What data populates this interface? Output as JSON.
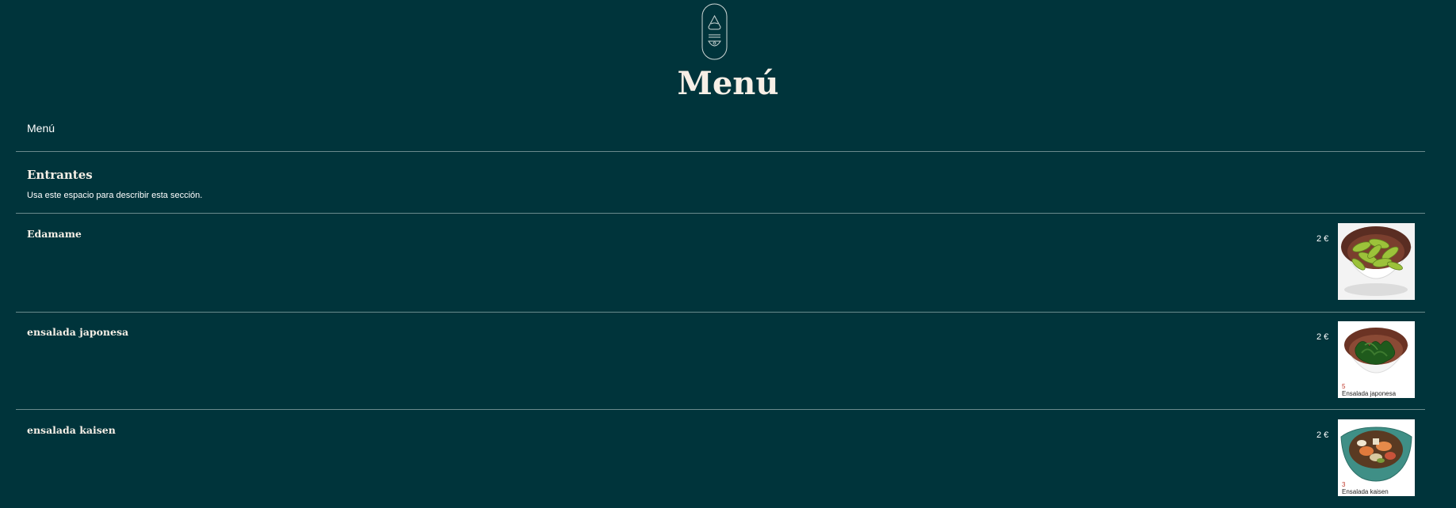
{
  "header": {
    "logo_icon": "onigiri-bowl-logo-icon",
    "title": "Menú"
  },
  "breadcrumb": "Menú",
  "section": {
    "title": "Entrantes",
    "description": "Usa este espacio para describir esta sección."
  },
  "items": [
    {
      "name": "Edamame",
      "price": "2 €",
      "image_icon": "edamame-bowl-image",
      "image_number": "",
      "image_caption": ""
    },
    {
      "name": "ensalada japonesa",
      "price": "2 €",
      "image_icon": "seaweed-salad-bowl-image",
      "image_number": "5",
      "image_caption": "Ensalada japonesa"
    },
    {
      "name": "ensalada kaisen",
      "price": "2 €",
      "image_icon": "kaisen-salad-bowl-image",
      "image_number": "3",
      "image_caption": "Ensalada kaisen"
    }
  ],
  "colors": {
    "background": "#00343b",
    "title": "#f6efe6",
    "divider": "#6b8a8d"
  }
}
